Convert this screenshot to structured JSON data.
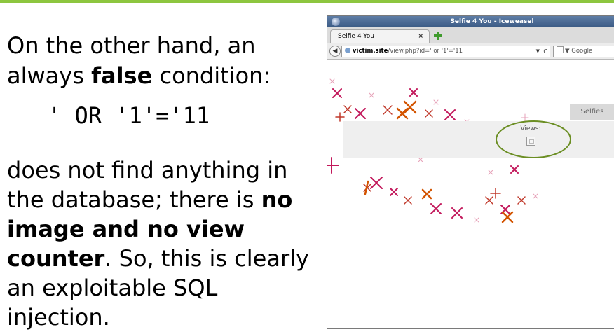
{
  "slide": {
    "intro": "On the other hand, an always ",
    "intro_bold": "false",
    "intro_end": " condition:",
    "payload": "' OR '1'='11",
    "body_1": "does not find anything in the database; there is ",
    "body_bold_1": "no image and no view counter",
    "body_2": ". So, this is clearly an exploitable SQL injection."
  },
  "browser": {
    "window_title": "Selfie 4 You - Iceweasel",
    "tab_label": "Selfie 4 You",
    "tab_close": "×",
    "url_host": "victim.site",
    "url_path": "/view.php?id=' or '1'='11",
    "url_dropdown": "▼",
    "reload_glyph": "C",
    "search_engine": "▼ Google",
    "icons": [
      "app-icon",
      "new-tab-icon",
      "back-arrow-icon",
      "site-globe-icon",
      "reload-icon",
      "broken-image-icon"
    ]
  },
  "page": {
    "nav_button": "Selfies",
    "views_label": "Views:"
  },
  "colors": {
    "accent_green": "#8dc63f",
    "oval_green": "#6b8e23",
    "doodle_red": "#c0392b",
    "doodle_pink": "#c2185b",
    "doodle_orange": "#d35400"
  }
}
